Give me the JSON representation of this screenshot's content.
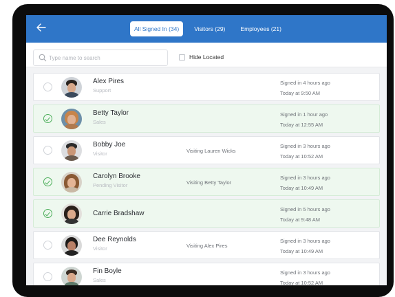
{
  "header": {
    "tabs": [
      {
        "label": "All Signed In (34)",
        "active": true
      },
      {
        "label": "Visitors (29)",
        "active": false
      },
      {
        "label": "Employees (21)",
        "active": false
      }
    ]
  },
  "search": {
    "placeholder": "Type name to search",
    "value": ""
  },
  "filters": {
    "hide_located_label": "Hide Located",
    "hide_located_checked": false
  },
  "rows": [
    {
      "name": "Alex Pires",
      "role": "Support",
      "visiting": "",
      "since": "Signed in 4 hours ago",
      "time": "Today at 9:50 AM",
      "selected": false
    },
    {
      "name": "Betty Taylor",
      "role": "Sales",
      "visiting": "",
      "since": "Signed in 1 hour ago",
      "time": "Today at 12:55 AM",
      "selected": true
    },
    {
      "name": "Bobby Joe",
      "role": "Visitor",
      "visiting": "Visiting Lauren Wicks",
      "since": "Signed in 3 hours ago",
      "time": "Today at 10:52 AM",
      "selected": false
    },
    {
      "name": "Carolyn Brooke",
      "role": "Pending Visitor",
      "visiting": "Visiting Betty Taylor",
      "since": "Signed in 3 hours ago",
      "time": "Today at 10:49 AM",
      "selected": true
    },
    {
      "name": "Carrie Bradshaw",
      "role": "",
      "visiting": "",
      "since": "Signed in 5 hours ago",
      "time": "Today at 9:48 AM",
      "selected": true
    },
    {
      "name": "Dee Reynolds",
      "role": "Visitor",
      "visiting": "Visiting Alex Pires",
      "since": "Signed in 3 hours ago",
      "time": "Today at 10:49 AM",
      "selected": false
    },
    {
      "name": "Fin Boyle",
      "role": "Sales",
      "visiting": "",
      "since": "Signed in 3 hours ago",
      "time": "Today at 10:52 AM",
      "selected": false
    }
  ],
  "colors": {
    "accent": "#2f76c8",
    "selected_row": "#eef8ef",
    "check": "#4cae5a"
  },
  "icons": {
    "back": "arrow-left-icon",
    "search": "search-icon",
    "check": "check-circle-icon"
  }
}
